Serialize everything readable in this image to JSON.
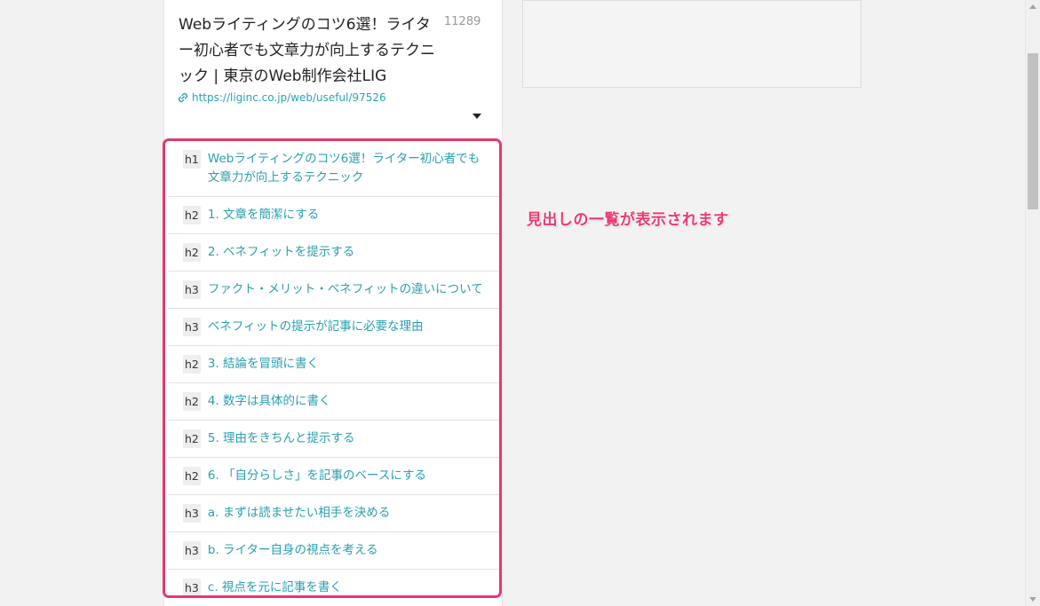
{
  "card": {
    "title": "Webライティングのコツ6選！ライター初心者でも文章力が向上するテクニック | 東京のWeb制作会社LIG",
    "count": "11289",
    "url": "https://liginc.co.jp/web/useful/97526"
  },
  "headings": [
    {
      "tag": "h1",
      "text": "Webライティングのコツ6選！ライター初心者でも文章力が向上するテクニック"
    },
    {
      "tag": "h2",
      "text": "1. 文章を簡潔にする"
    },
    {
      "tag": "h2",
      "text": "2. ベネフィットを提示する"
    },
    {
      "tag": "h3",
      "text": "ファクト・メリット・ベネフィットの違いについて"
    },
    {
      "tag": "h3",
      "text": "ベネフィットの提示が記事に必要な理由"
    },
    {
      "tag": "h2",
      "text": "3. 結論を冒頭に書く"
    },
    {
      "tag": "h2",
      "text": "4. 数字は具体的に書く"
    },
    {
      "tag": "h2",
      "text": "5. 理由をきちんと提示する"
    },
    {
      "tag": "h2",
      "text": "6. 「自分らしさ」を記事のベースにする"
    },
    {
      "tag": "h3",
      "text": "a. まずは読ませたい相手を決める"
    },
    {
      "tag": "h3",
      "text": "b. ライター自身の視点を考える"
    },
    {
      "tag": "h3",
      "text": "c. 視点を元に記事を書く"
    }
  ],
  "annotation": "見出しの一覧が表示されます",
  "colors": {
    "link": "#2a9fb0",
    "highlight": "#e8386c",
    "annotation": "#ea3b72"
  }
}
